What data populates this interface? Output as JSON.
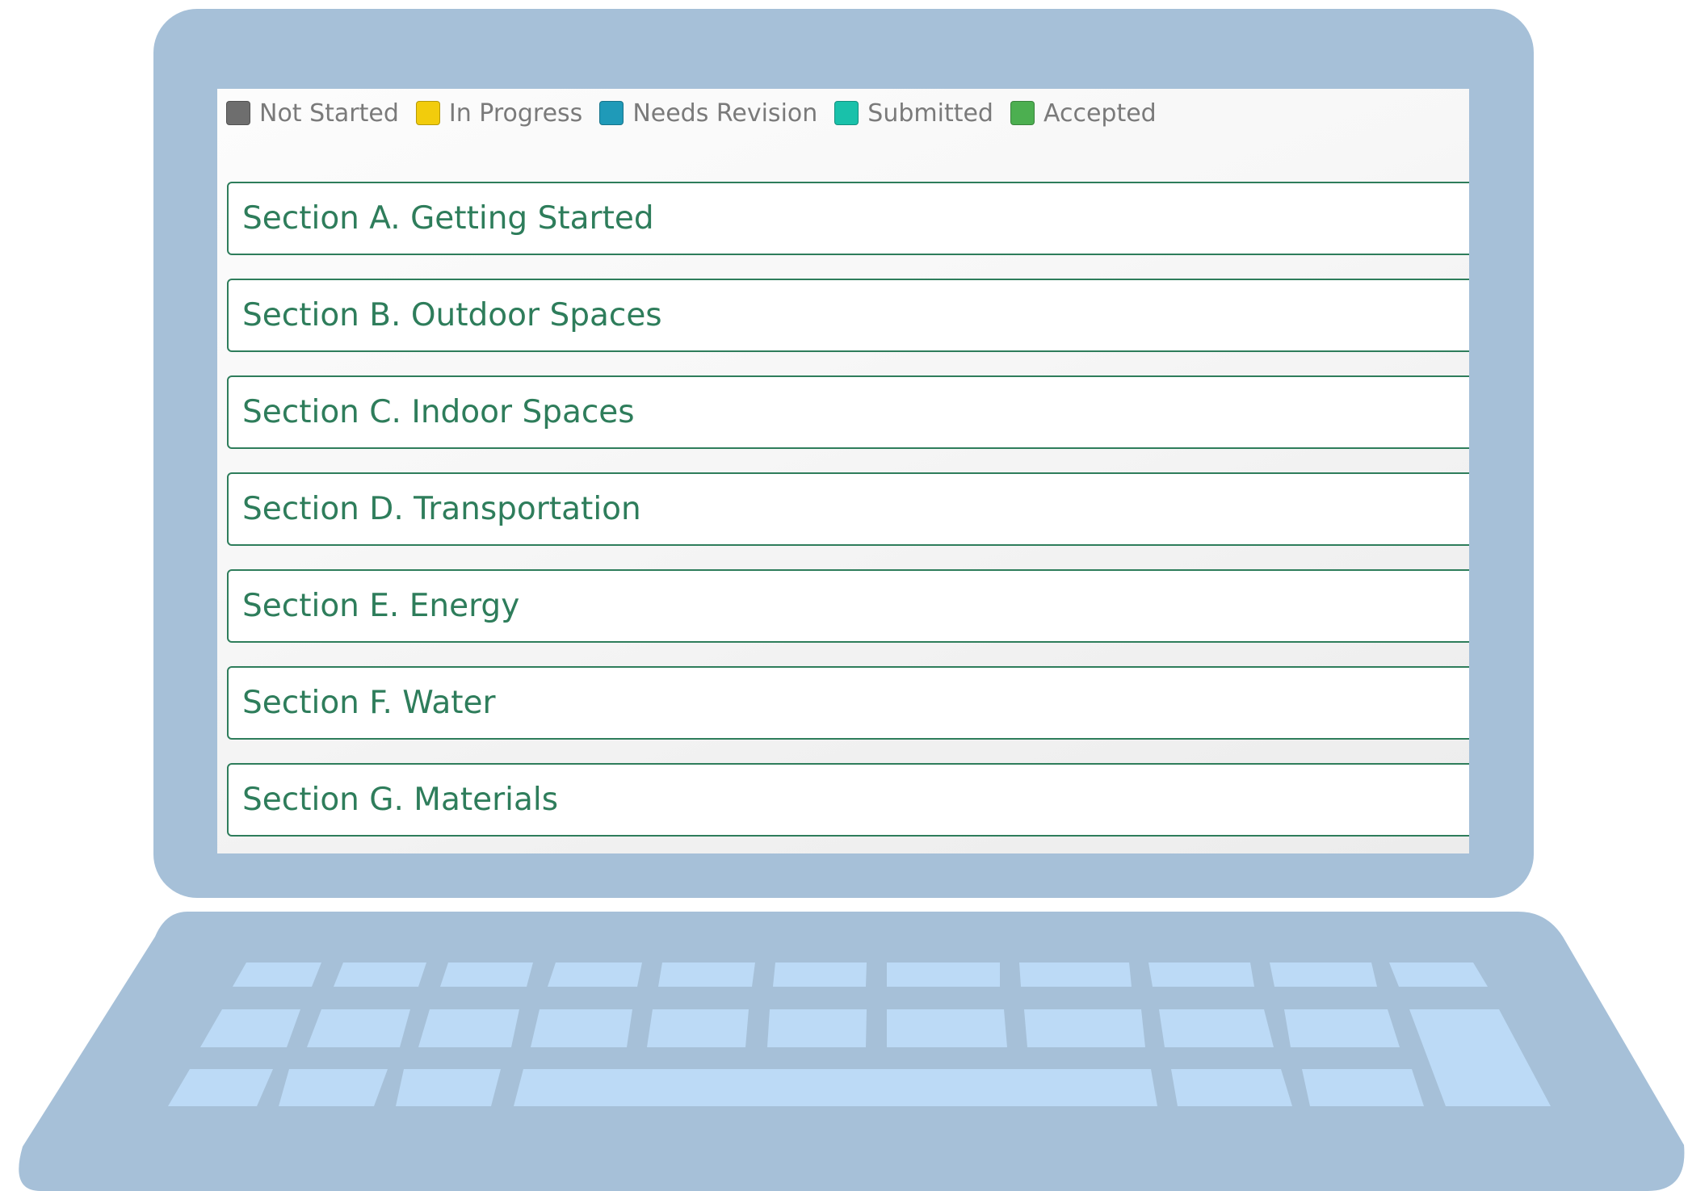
{
  "legend": {
    "items": [
      {
        "label": "Not Started",
        "color": "#6e6e6e"
      },
      {
        "label": "In Progress",
        "color": "#f2cc0c"
      },
      {
        "label": "Needs Revision",
        "color": "#1f9ab8"
      },
      {
        "label": "Submitted",
        "color": "#19c1aa"
      },
      {
        "label": "Accepted",
        "color": "#4caf50"
      }
    ]
  },
  "sections": [
    {
      "label": "Section A. Getting Started"
    },
    {
      "label": "Section B. Outdoor Spaces"
    },
    {
      "label": "Section C. Indoor Spaces"
    },
    {
      "label": "Section D. Transportation"
    },
    {
      "label": "Section E. Energy"
    },
    {
      "label": "Section F. Water"
    },
    {
      "label": "Section G. Materials"
    }
  ],
  "colors": {
    "accent": "#2e7d5b",
    "laptop_body": "#a6c0d8",
    "keyboard_keys": "#bcdaf6"
  }
}
